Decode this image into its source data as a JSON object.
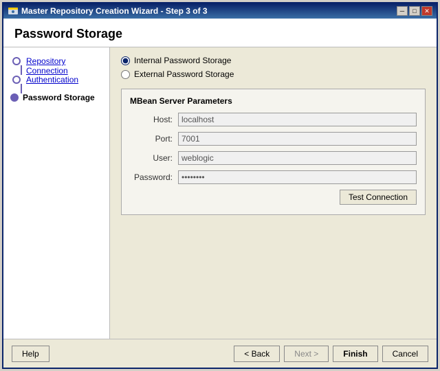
{
  "window": {
    "title": "Master Repository Creation Wizard - Step 3 of 3",
    "close_btn": "✕",
    "minimize_btn": "─",
    "maximize_btn": "□"
  },
  "page_title": "Password Storage",
  "sidebar": {
    "items": [
      {
        "id": "repository-connection",
        "label": "Repository Connection",
        "state": "done"
      },
      {
        "id": "authentication",
        "label": "Authentication",
        "state": "done"
      },
      {
        "id": "password-storage",
        "label": "Password Storage",
        "state": "active"
      }
    ]
  },
  "radio_options": [
    {
      "id": "internal",
      "label": "Internal Password Storage",
      "checked": true
    },
    {
      "id": "external",
      "label": "External Password Storage",
      "checked": false
    }
  ],
  "section": {
    "title": "MBean Server Parameters",
    "fields": [
      {
        "label": "Host:",
        "value": "localhost",
        "type": "text",
        "id": "host"
      },
      {
        "label": "Port:",
        "value": "7001",
        "type": "text",
        "id": "port"
      },
      {
        "label": "User:",
        "value": "weblogic",
        "type": "text",
        "id": "user"
      },
      {
        "label": "Password:",
        "value": "••••••••",
        "type": "password",
        "id": "password"
      }
    ],
    "test_button": "Test Connection"
  },
  "footer": {
    "help_btn": "Help",
    "back_btn": "< Back",
    "next_btn": "Next >",
    "finish_btn": "Finish",
    "cancel_btn": "Cancel"
  }
}
